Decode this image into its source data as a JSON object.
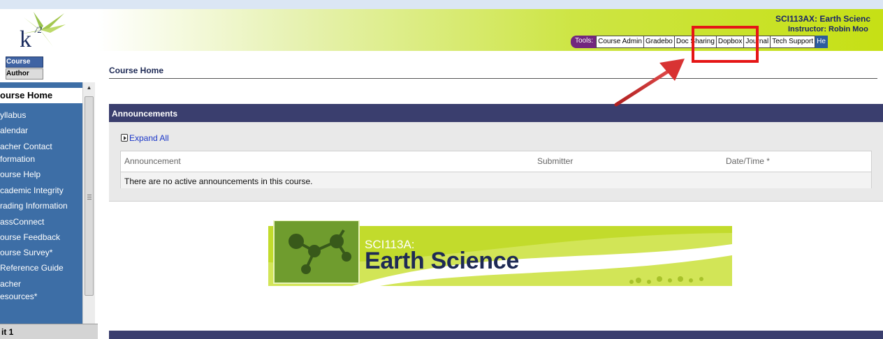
{
  "header": {
    "logo_text": "k12",
    "course_title": "SCI113AX: Earth Scienc",
    "instructor": "Instructor:  Robin Moo"
  },
  "toolbar": {
    "label": "Tools:",
    "items": [
      "Course Admin",
      "Gradebook",
      "Doc Sharing",
      "Dropbox",
      "Journal",
      "Tech Support",
      "He"
    ],
    "visible": [
      "Course Admin",
      "Gradebo",
      "Doc Sharing",
      "D",
      "opbox",
      "Journal",
      "Tech Support",
      "He"
    ]
  },
  "sidebar": {
    "tab_course": "Course",
    "tab_author": "Author",
    "home": "ourse Home",
    "items": [
      "yllabus",
      "alendar",
      "acher Contact",
      "formation",
      "ourse Help",
      "cademic Integrity",
      "rading Information",
      "assConnect",
      "ourse Feedback",
      "ourse Survey*",
      "Reference Guide",
      "acher",
      "esources*"
    ],
    "unit": "it 1"
  },
  "main": {
    "title": "Course Home",
    "announcements_header": "Announcements",
    "expand_all": "Expand All",
    "columns": [
      "Announcement",
      "Submitter",
      "Date/Time *"
    ],
    "empty_message": "There are no active announcements in this course."
  },
  "banner": {
    "subtitle": "SCI113A:",
    "title": "Earth Science"
  },
  "colors": {
    "nav_blue": "#3d6ea6",
    "header_green": "#c6e015",
    "section_header": "#3a3e6e",
    "tools_purple": "#72267e",
    "highlight_red": "#e51616"
  }
}
